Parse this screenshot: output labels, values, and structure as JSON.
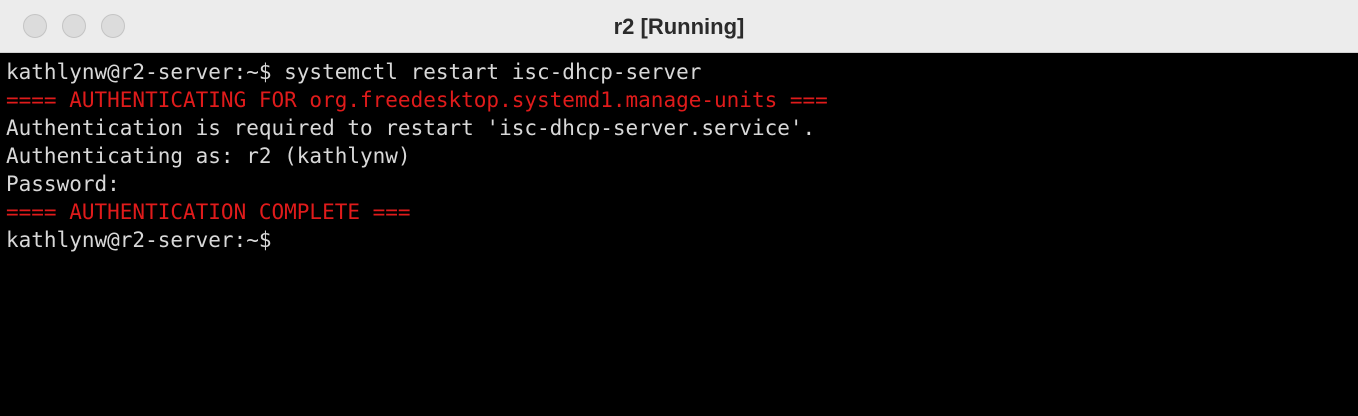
{
  "window": {
    "title": "r2 [Running]",
    "controls": {
      "close": "close-button",
      "minimize": "minimize-button",
      "zoom": "zoom-button"
    }
  },
  "terminal": {
    "lines": [
      {
        "text": "kathlynw@r2-server:~$ systemctl restart isc-dhcp-server",
        "color": "#d8d8d8"
      },
      {
        "text": "==== AUTHENTICATING FOR org.freedesktop.systemd1.manage-units ===",
        "color": "#e01b1b"
      },
      {
        "text": "Authentication is required to restart 'isc-dhcp-server.service'.",
        "color": "#d8d8d8"
      },
      {
        "text": "Authenticating as: r2 (kathlynw)",
        "color": "#d8d8d8"
      },
      {
        "text": "Password:",
        "color": "#d8d8d8"
      },
      {
        "text": "==== AUTHENTICATION COMPLETE ===",
        "color": "#e01b1b"
      },
      {
        "text": "kathlynw@r2-server:~$",
        "color": "#d8d8d8"
      }
    ]
  },
  "colors": {
    "titlebar_bg": "#ececec",
    "terminal_bg": "#000000",
    "terminal_fg": "#d8d8d8",
    "auth_red": "#e01b1b"
  }
}
